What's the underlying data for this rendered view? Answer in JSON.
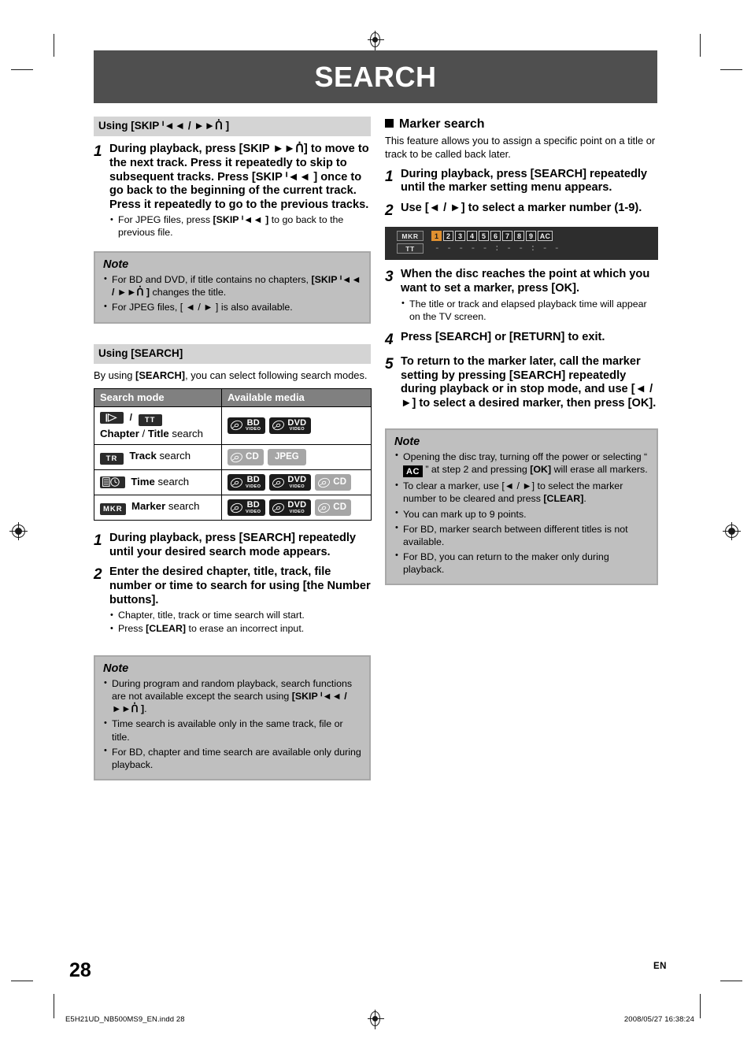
{
  "page": {
    "title": "SEARCH",
    "page_number": "28",
    "language_code": "EN",
    "file_stamp": "E5H21UD_NB500MS9_EN.indd   28",
    "time_stamp": "2008/05/27   16:38:24",
    "banner_color": "#4f4f4f",
    "note_bg_color": "#bfbfbf",
    "table_header_color": "#808080",
    "marker_highlight_color": "#e09030"
  },
  "left": {
    "skip_section": {
      "header": "Using [SKIP ᑊ◄◄ / ►►ᑏ ]",
      "steps": [
        {
          "num": "1",
          "headline": "During playback, press [SKIP ►►ᑏ] to move to the next track. Press it repeatedly to skip to subsequent tracks. Press [SKIP ᑊ◄◄ ] once to go back to the beginning of the current track. Press it repeatedly to go to the previous tracks.",
          "bullets": [
            "For JPEG files, press [SKIP ᑊ◄◄ ] to go back to the previous file."
          ]
        }
      ],
      "note": {
        "title": "Note",
        "bullets": [
          "For BD and DVD, if title contains no chapters, [SKIP ᑊ◄◄ / ►►ᑏ ] changes the title.",
          "For JPEG files,  [ ◄ / ► ] is also available."
        ]
      }
    },
    "search_section": {
      "header": "Using [SEARCH]",
      "intro": "By using [SEARCH], you can select following search modes.",
      "table": {
        "columns": [
          "Search mode",
          "Available media"
        ],
        "rows": [
          {
            "icons": [
              "chapter-icon",
              "TT"
            ],
            "label_bold": "Chapter",
            "label_sep": " / ",
            "label_bold2": "Title",
            "label_tail": " search",
            "media": [
              "BD Video",
              "DVD Video"
            ]
          },
          {
            "icons": [
              "TR"
            ],
            "label_bold": "Track",
            "label_tail": " search",
            "media": [
              "CD",
              "JPEG"
            ]
          },
          {
            "icons": [
              "time-icon"
            ],
            "label_bold": "Time",
            "label_tail": " search",
            "media": [
              "BD Video",
              "DVD Video",
              "CD"
            ]
          },
          {
            "icons": [
              "MKR"
            ],
            "label_bold": "Marker",
            "label_tail": " search",
            "media": [
              "BD Video",
              "DVD Video",
              "CD"
            ]
          }
        ]
      },
      "steps": [
        {
          "num": "1",
          "headline": "During playback, press [SEARCH] repeatedly until your desired search mode appears.",
          "bullets": []
        },
        {
          "num": "2",
          "headline": "Enter the desired chapter, title, track, file number or time to search for using [the Number buttons].",
          "bullets": [
            "Chapter, title, track or time search will start.",
            "Press [CLEAR] to erase an incorrect input."
          ]
        }
      ],
      "note": {
        "title": "Note",
        "bullets": [
          "During program and random playback, search functions are not available except the search using [SKIP ᑊ◄◄ / ►►ᑏ ].",
          "Time search is available only in the same track, file or title.",
          "For BD, chapter and time search are available only during playback."
        ]
      }
    }
  },
  "right": {
    "marker_section": {
      "heading": "Marker search",
      "intro": "This feature allows you to assign a specific point on a title or track to be called back later.",
      "steps": [
        {
          "num": "1",
          "headline": "During playback, press [SEARCH] repeatedly until the marker setting menu appears.",
          "bullets": []
        },
        {
          "num": "2",
          "headline": "Use [◄ / ►] to select a marker number (1-9).",
          "bullets": []
        },
        {
          "num": "3",
          "headline": "When the disc reaches the point at which you want to set a marker, press [OK].",
          "bullets": [
            "The title or track and elapsed playback time will appear on the TV screen."
          ]
        },
        {
          "num": "4",
          "headline": "Press [SEARCH] or [RETURN] to exit.",
          "bullets": []
        },
        {
          "num": "5",
          "headline": "To return to the marker later, call the marker setting by pressing [SEARCH] repeatedly during playback or in stop mode, and use [◄ / ►] to select a desired marker, then press [OK].",
          "bullets": []
        }
      ],
      "osd": {
        "row1_tag": "MKR",
        "row2_tag": "TT",
        "numbers": [
          "1",
          "2",
          "3",
          "4",
          "5",
          "6",
          "7",
          "8",
          "9"
        ],
        "all_clear": "AC",
        "selected": "1",
        "time_value": "- - -   - - : - - : - -"
      },
      "note": {
        "title": "Note",
        "bullets": [
          "Opening the disc tray, turning off the power or selecting “ AC ” at step 2 and pressing [OK] will erase all markers.",
          "To clear a marker, use [◄ / ►] to select the marker number to be cleared and press [CLEAR].",
          "You can mark up to 9 points.",
          "For BD, marker search between different titles is not available.",
          "For BD, you can return to the maker only during playback."
        ]
      }
    }
  }
}
